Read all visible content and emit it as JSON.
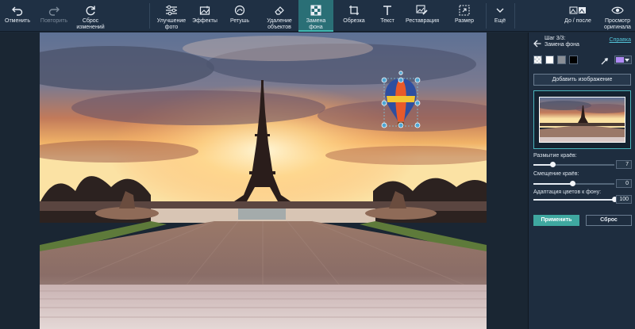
{
  "toolbar": {
    "undo": "Отменить",
    "redo": "Повторить",
    "reset_changes": "Сброс\nизменений",
    "enhance": "Улучшение\nфото",
    "effects": "Эффекты",
    "retouch": "Ретушь",
    "remove_objects": "Удаление\nобъектов",
    "bg_replace": "Замена\nфона",
    "crop": "Обрезка",
    "text": "Текст",
    "restoration": "Реставрация",
    "resize": "Размер",
    "more": "Ещё",
    "before_after": "До / после",
    "view_original": "Просмотр\nоригинала"
  },
  "panel": {
    "step_title": "Шаг 3/3:\nЗамена фона",
    "help": "Справка",
    "add_image": "Добавить изображение",
    "edge_blur_label": "Размытие краёв:",
    "edge_blur_value": "7",
    "edge_shift_label": "Смещение краёв:",
    "edge_shift_value": "0",
    "color_adapt_label": "Адаптация цветов к фону:",
    "color_adapt_value": "100",
    "apply": "Применить",
    "reset": "Сброс"
  },
  "sliders": {
    "edge_blur_fraction": 0.24,
    "edge_shift_fraction": 0.48,
    "color_adapt_fraction": 1.0
  },
  "swatch_colors": [
    "transparent",
    "#ffffff",
    "#8a8f96",
    "#000000"
  ],
  "picked_color": "#b08af5",
  "colors": {
    "accent": "#3fa8a0",
    "toolbar_bg": "#1f3044",
    "panel_bg": "#1e2d3f",
    "link": "#53c4d8"
  }
}
